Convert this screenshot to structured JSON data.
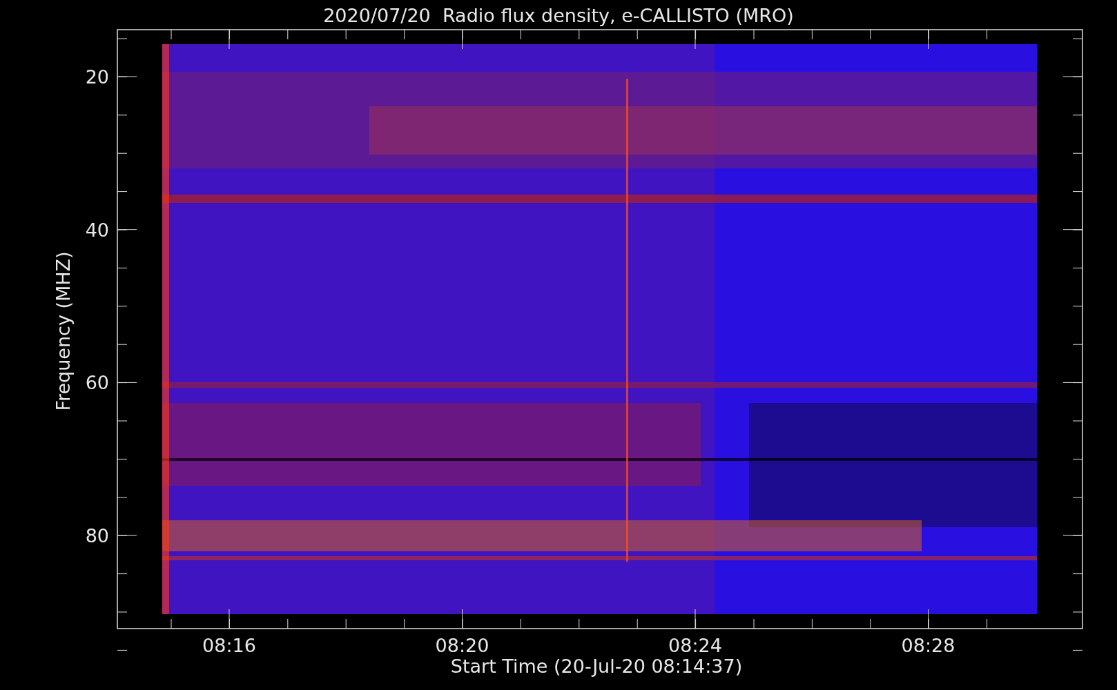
{
  "title": "2020/07/20  Radio flux density, e-CALLISTO (MRO)",
  "y_axis": {
    "label": "Frequency (MHZ)",
    "ticks": [
      "20",
      "40",
      "60",
      "80"
    ]
  },
  "x_axis": {
    "label": "Start Time (20-Jul-20 08:14:37)",
    "ticks": [
      "08:16",
      "08:20",
      "08:24",
      "08:28"
    ]
  }
}
